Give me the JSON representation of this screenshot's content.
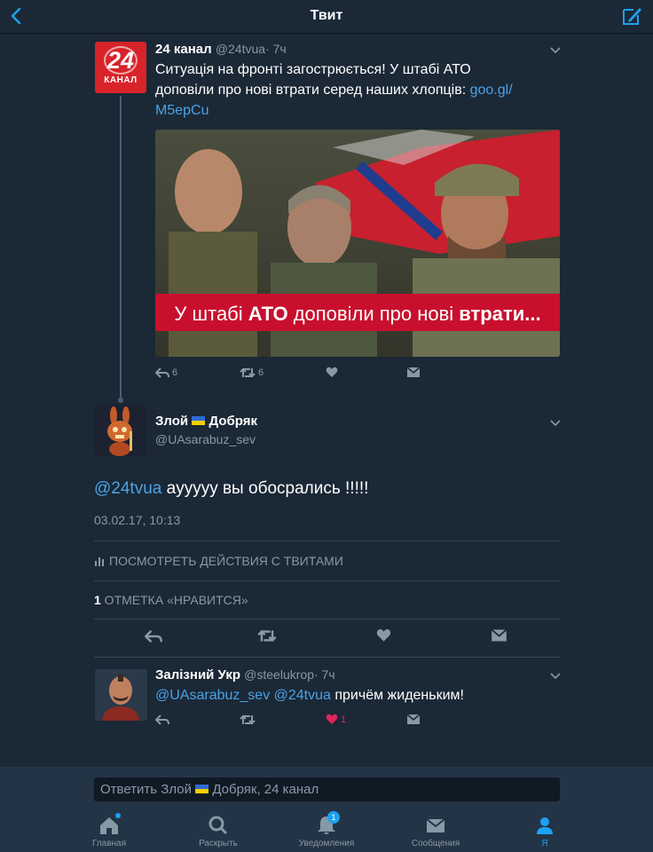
{
  "nav": {
    "title": "Твит"
  },
  "quoted_tweet": {
    "avatar_number": "24",
    "avatar_label": "КАНАЛ",
    "name": "24 канал",
    "handle": "@24tvua",
    "time": "· 7ч",
    "text_line1": "Ситуація на фронті загострюється! У штабі АТО",
    "text_line2_plain": "доповіли про нові втрати серед наших хлопців: ",
    "text_line2_link": "goo.gl/",
    "text_line3_link": "M5epCu",
    "media_banner": {
      "p1": "У штабі ",
      "p2": "АТО",
      "p3": " доповіли про нові ",
      "p4": "втрати..."
    },
    "reply_count": "6",
    "retweet_count": "6"
  },
  "main_tweet": {
    "name_part1": "Злой",
    "name_part2": "Добряк",
    "handle": "@UAsarabuz_sev",
    "mention": "@24tvua",
    "text": " ayyyyy вы обосрались !!!!!",
    "timestamp": "03.02.17, 10:13",
    "activity_label": "ПОСМОТРЕТЬ ДЕЙСТВИЯ С ТВИТАМИ",
    "likes_count": "1",
    "likes_label": " ОТМЕТКА «НРАВИТСЯ»"
  },
  "reply_tweet": {
    "name": "Залізний Укр",
    "handle": "@steelukrop",
    "time": "· 7ч",
    "mention1": "@UAsarabuz_sev",
    "mention2": "@24tvua",
    "text": " причём жиденьким!",
    "like_count": "1"
  },
  "reply_composer": {
    "placeholder_part1": "Ответить Злой",
    "placeholder_part2": " Добряк, 24 канал"
  },
  "tabbar": {
    "home": "Главная",
    "explore": "Раскрыть",
    "notifications": "Уведомления",
    "notifications_badge": "1",
    "messages": "Сообщения",
    "me": "Я"
  },
  "colors": {
    "background": "#1b2836",
    "accent": "#1da1f2",
    "link": "#4aa3e6",
    "like": "#e0245e",
    "channel_red": "#d8232a"
  }
}
